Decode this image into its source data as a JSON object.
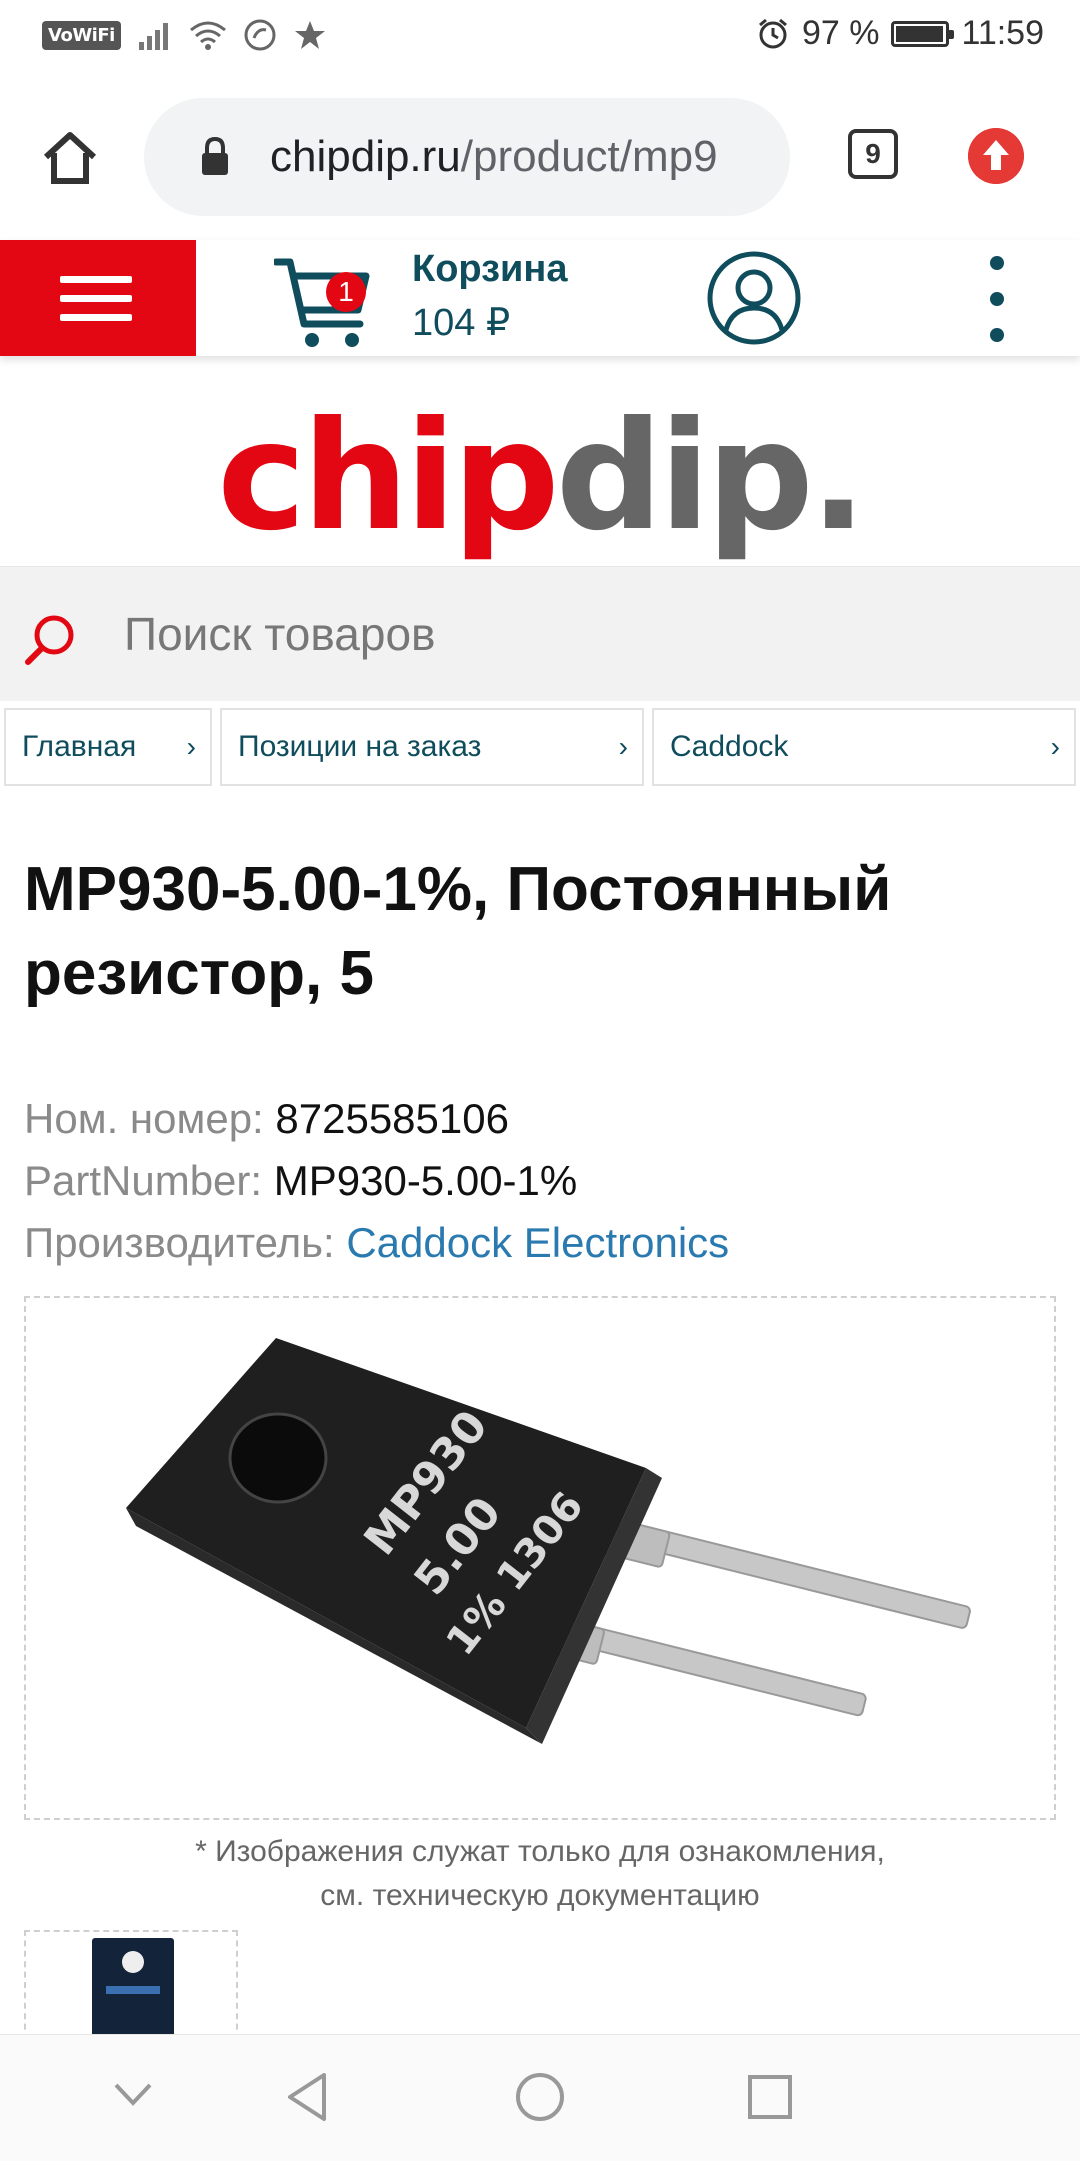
{
  "status_bar": {
    "carrier_badge": "VoWiFi",
    "battery_percent": "97 %",
    "battery_level": 0.97,
    "time": "11:59",
    "icons": [
      "signal-icon",
      "wifi-icon",
      "alarm-icon",
      "battery-icon"
    ]
  },
  "browser": {
    "url_host": "chipdip.ru",
    "url_path": "/product/mp9",
    "tab_count": "9"
  },
  "header": {
    "cart_count": "1",
    "cart_label": "Корзина",
    "cart_total": "104 ₽"
  },
  "logo": {
    "part1": "chip",
    "part2": "dip."
  },
  "search": {
    "placeholder": "Поиск товаров"
  },
  "breadcrumb": [
    {
      "label": "Главная"
    },
    {
      "label": "Позиции на заказ"
    },
    {
      "label": "Caddock"
    }
  ],
  "product": {
    "title": "MP930-5.00-1%, Постоянный резистор, 5",
    "nom_label": "Ном. номер:",
    "nom_value": "8725585106",
    "pn_label": "PartNumber:",
    "pn_value": "MP930-5.00-1%",
    "mfr_label": "Производитель:",
    "mfr_value": "Caddock Electronics",
    "image_caption_line1": "* Изображения служат только для ознакомления,",
    "image_caption_line2": "см. техническую документацию"
  },
  "colors": {
    "brand_red": "#e30613",
    "brand_dark": "#0f4c5c",
    "link_blue": "#2a7ab0"
  }
}
